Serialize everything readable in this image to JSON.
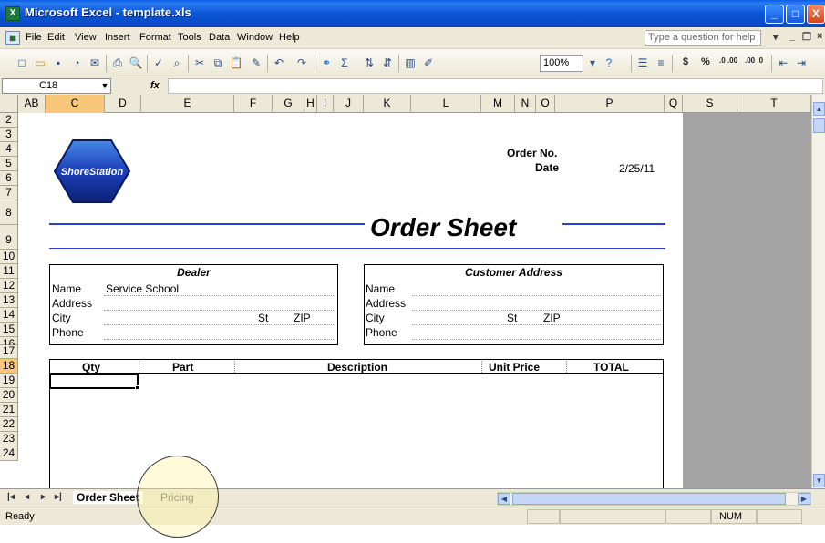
{
  "window": {
    "title": "Microsoft Excel - template.xls",
    "minimize_glyph": "_",
    "maximize_glyph": "□",
    "close_glyph": "X"
  },
  "menu": {
    "items": [
      "File",
      "Edit",
      "View",
      "Insert",
      "Format",
      "Tools",
      "Data",
      "Window",
      "Help"
    ],
    "help_placeholder": "Type a question for help",
    "help_arrow": "▾",
    "doc_minimize": "_",
    "doc_restore": "❐",
    "doc_close": "×"
  },
  "toolbar": {
    "zoom": "100%",
    "currency": "$",
    "percent": "%",
    "inc_decimal": ".0 .00",
    "dec_decimal": ".00 .0"
  },
  "formula_bar": {
    "name_box": "C18",
    "fx": "fx",
    "formula": ""
  },
  "columns": [
    "AB",
    "C",
    "D",
    "E",
    "F",
    "G",
    "H",
    "I",
    "J",
    "K",
    "L",
    "M",
    "N",
    "O",
    "P",
    "Q",
    "S",
    "T"
  ],
  "rows": [
    "2",
    "3",
    "4",
    "5",
    "6",
    "7",
    "8",
    "9",
    "10",
    "11",
    "12",
    "13",
    "14",
    "15",
    "16",
    "17",
    "18",
    "19",
    "20",
    "21",
    "22",
    "23",
    "24"
  ],
  "sheet": {
    "logo_text": "ShoreStation",
    "order_no_label": "Order No.",
    "date_label": "Date",
    "date_value": "2/25/11",
    "title": "Order Sheet",
    "dealer": {
      "heading": "Dealer",
      "name_label": "Name",
      "name_value": "Service School",
      "address_label": "Address",
      "city_label": "City",
      "st_label": "St",
      "zip_label": "ZIP",
      "phone_label": "Phone"
    },
    "customer": {
      "heading": "Customer Address",
      "name_label": "Name",
      "address_label": "Address",
      "city_label": "City",
      "st_label": "St",
      "zip_label": "ZIP",
      "phone_label": "Phone"
    },
    "table_headers": {
      "qty": "Qty",
      "part": "Part",
      "description": "Description",
      "unit_price": "Unit Price",
      "total": "TOTAL"
    }
  },
  "tabs": {
    "nav": [
      "|◂",
      "◂",
      "▸",
      "▸|"
    ],
    "sheets": [
      "Order Sheet",
      "Pricing"
    ]
  },
  "status": {
    "ready": "Ready",
    "num": "NUM"
  },
  "colors": {
    "titlebar": "#0a5ce8",
    "accent_line": "#2b3fd6",
    "selected_header": "#f9c77a",
    "gray_area": "#a3a3a3"
  }
}
